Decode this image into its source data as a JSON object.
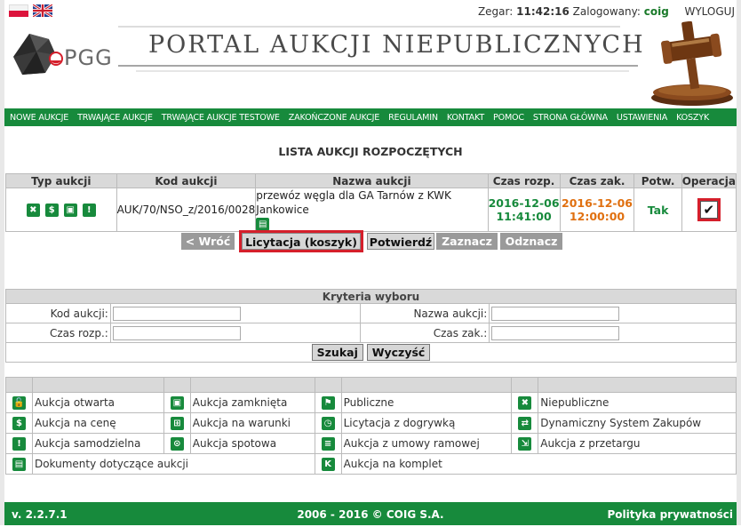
{
  "header": {
    "clock_label": "Zegar:",
    "clock_value": "11:42:16",
    "user_label": "Zalogowany:",
    "user_value": "coig",
    "logout": "WYLOGUJ",
    "logo_text": "PGG",
    "portal_title": "PORTAL AUKCJI NIEPUBLICZNYCH",
    "lang_icons": [
      "flag-pl-icon",
      "flag-uk-icon"
    ]
  },
  "nav": [
    "NOWE AUKCJE",
    "TRWAJĄCE AUKCJE",
    "TRWAJĄCE AUKCJE TESTOWE",
    "ZAKOŃCZONE AUKCJE",
    "REGULAMIN",
    "KONTAKT",
    "POMOC",
    "STRONA GŁÓWNA",
    "USTAWIENIA",
    "KOSZYK"
  ],
  "list_title": "LISTA AUKCJI ROZPOCZĘTYCH",
  "auction_table": {
    "headers": [
      "Typ aukcji",
      "Kod aukcji",
      "Nazwa aukcji",
      "Czas rozp.",
      "Czas zak.",
      "Potw.",
      "Operacja"
    ],
    "rows": [
      {
        "type_icons": [
          "non-public-icon",
          "price-icon",
          "closed-icon",
          "standalone-icon"
        ],
        "code": "AUK/70/NSO_z/2016/0028",
        "name": "przewóz węgla dla GA Tarnów z KWK Jankowice",
        "start_date": "2016-12-06",
        "start_time": "11:41:00",
        "end_date": "2016-12-06",
        "end_time": "12:00:00",
        "confirmed": "Tak",
        "checked": "✔"
      }
    ]
  },
  "actions": {
    "back": "< Wróć",
    "bidding": "Licytacja (koszyk)",
    "confirm": "Potwierdź",
    "select": "Zaznacz",
    "deselect": "Odznacz"
  },
  "criteria": {
    "title": "Kryteria wyboru",
    "code_label": "Kod aukcji:",
    "name_label": "Nazwa aukcji:",
    "start_label": "Czas rozp.:",
    "end_label": "Czas zak.:",
    "search": "Szukaj",
    "clear": "Wyczyść"
  },
  "legend": {
    "rows": [
      [
        {
          "icon": "open-lock-icon",
          "glyph": "🔓",
          "label": "Aukcja otwarta"
        },
        {
          "icon": "closed-lock-icon",
          "glyph": "🔒",
          "label": "Aukcja zamknięta"
        },
        {
          "icon": "flag-icon",
          "glyph": "⚑",
          "label": "Publiczne"
        },
        {
          "icon": "non-public-icon",
          "glyph": "✖",
          "label": "Niepubliczne"
        }
      ],
      [
        {
          "icon": "dollar-icon",
          "glyph": "$",
          "label": "Aukcja na cenę"
        },
        {
          "icon": "cart-icon",
          "glyph": "⊞",
          "label": "Aukcja na warunki"
        },
        {
          "icon": "clock-icon",
          "glyph": "◷",
          "label": "Licytacja z dogrywką"
        },
        {
          "icon": "shuffle-icon",
          "glyph": "⇄",
          "label": "Dynamiczny System Zakupów"
        }
      ],
      [
        {
          "icon": "exclamation-icon",
          "glyph": "!",
          "label": "Aukcja samodzielna"
        },
        {
          "icon": "timer-icon",
          "glyph": "⊙",
          "label": "Aukcja spotowa"
        },
        {
          "icon": "contract-icon",
          "glyph": "≡",
          "label": "Aukcja z umowy ramowej"
        },
        {
          "icon": "tender-icon",
          "glyph": "⇲",
          "label": "Aukcja z przetargu"
        }
      ],
      [
        {
          "icon": "document-icon",
          "glyph": "▤",
          "label": "Dokumenty dotyczące aukcji"
        },
        {
          "icon": "k-icon",
          "glyph": "K",
          "label": "Aukcja na komplet"
        }
      ]
    ]
  },
  "footer": {
    "version": "v. 2.2.7.1",
    "copyright": "2006 - 2016 © COIG S.A.",
    "privacy": "Polityka prywatności"
  },
  "colors": {
    "green": "#178a3c",
    "orange": "#e07010",
    "highlight_red": "#d51f2b"
  }
}
